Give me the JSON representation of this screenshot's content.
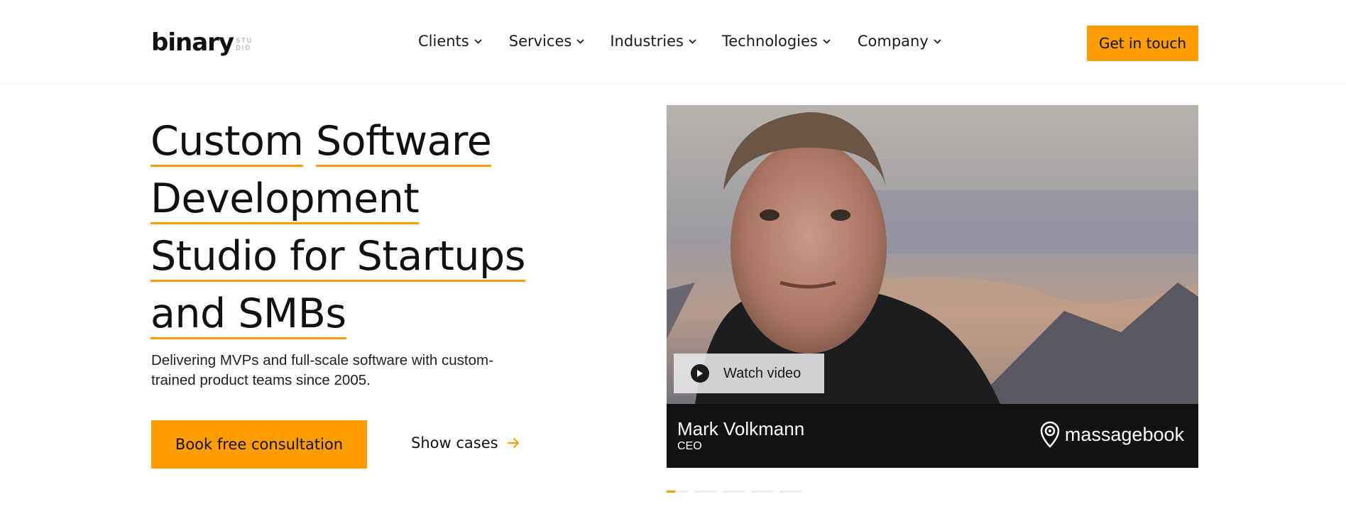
{
  "header": {
    "logo": {
      "main": "binary",
      "sub": [
        "STU",
        "DIO"
      ]
    },
    "nav": [
      {
        "label": "Clients"
      },
      {
        "label": "Services"
      },
      {
        "label": "Industries"
      },
      {
        "label": "Technologies"
      },
      {
        "label": "Company"
      }
    ],
    "cta_label": "Get in touch"
  },
  "hero": {
    "title_words": [
      "Custom",
      "Software",
      "Development",
      "Studio for Startups",
      "and SMBs"
    ],
    "subtitle": "Delivering MVPs and full-scale software with custom-trained product teams since 2005.",
    "primary_button": "Book free consultation",
    "secondary_link": "Show cases"
  },
  "testimonial": {
    "watch_label": "Watch video",
    "person_name": "Mark Volkmann",
    "person_role": "CEO",
    "brand": "massagebook",
    "slides_total": 5,
    "active_slide": 1
  },
  "colors": {
    "accent": "#ff9c00",
    "caption_bg": "#121212",
    "text": "#111111"
  },
  "icons": [
    "chevron-down-icon",
    "arrow-right-icon",
    "play-icon",
    "location-pin-icon"
  ]
}
